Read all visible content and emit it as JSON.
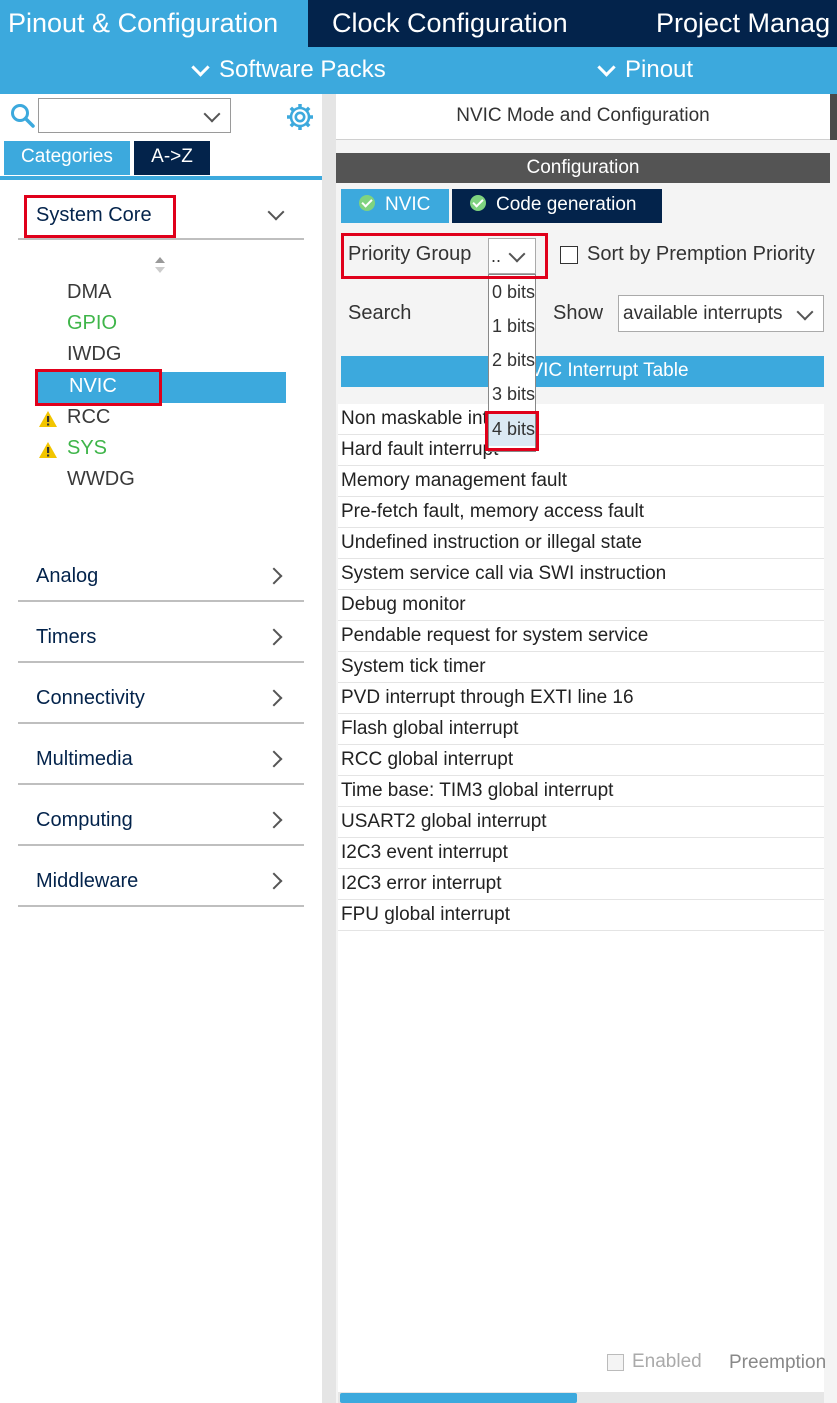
{
  "top_tabs": [
    "Pinout & Configuration",
    "Clock Configuration",
    "Project Manag"
  ],
  "subbar": {
    "software_packs": "Software Packs",
    "pinout": "Pinout"
  },
  "left": {
    "category_tabs": [
      "Categories",
      "A->Z"
    ],
    "system_core": {
      "label": "System Core",
      "items": [
        "DMA",
        "GPIO",
        "IWDG",
        "NVIC",
        "RCC",
        "SYS",
        "WWDG"
      ],
      "selected": "NVIC"
    },
    "sections": [
      "Analog",
      "Timers",
      "Connectivity",
      "Multimedia",
      "Computing",
      "Middleware"
    ]
  },
  "right": {
    "mode_title": "NVIC Mode and Configuration",
    "config_title": "Configuration",
    "sub_tabs": [
      "NVIC",
      "Code generation"
    ],
    "priority_group_label": "Priority Group",
    "priority_group_value": "..",
    "sort_label": "Sort by Premption Priority",
    "search_label": "Search",
    "show_label": "Show",
    "show_value": "available interrupts",
    "table_header": "VIC Interrupt Table",
    "dropdown_options": [
      "0 bits",
      "1 bits",
      "2 bits",
      "3 bits",
      "4 bits"
    ],
    "dropdown_selected": "4 bits",
    "interrupts": [
      "Non maskable interrupt",
      "Hard fault interrupt",
      "Memory management fault",
      "Pre-fetch fault, memory access fault",
      "Undefined instruction or illegal state",
      "System service call via SWI instruction",
      "Debug monitor",
      "Pendable request for system service",
      "System tick timer",
      "PVD interrupt through EXTI line 16",
      "Flash global interrupt",
      "RCC global interrupt",
      "Time base: TIM3 global interrupt",
      "USART2 global interrupt",
      "I2C3 event interrupt",
      "I2C3 error interrupt",
      "FPU global interrupt"
    ],
    "footer": {
      "enabled_label": "Enabled",
      "preemption_label": "Preemption"
    }
  },
  "colors": {
    "accent": "#3ca9dd",
    "navy": "#03234b",
    "highlight_red": "#e0001b",
    "green": "#3fb54a",
    "warning": "#f2c500"
  },
  "icons": [
    "search-icon",
    "gear-icon",
    "chevron-down-icon",
    "chevron-right-icon",
    "sort-arrows-icon",
    "warning-icon",
    "check-circle-icon"
  ]
}
